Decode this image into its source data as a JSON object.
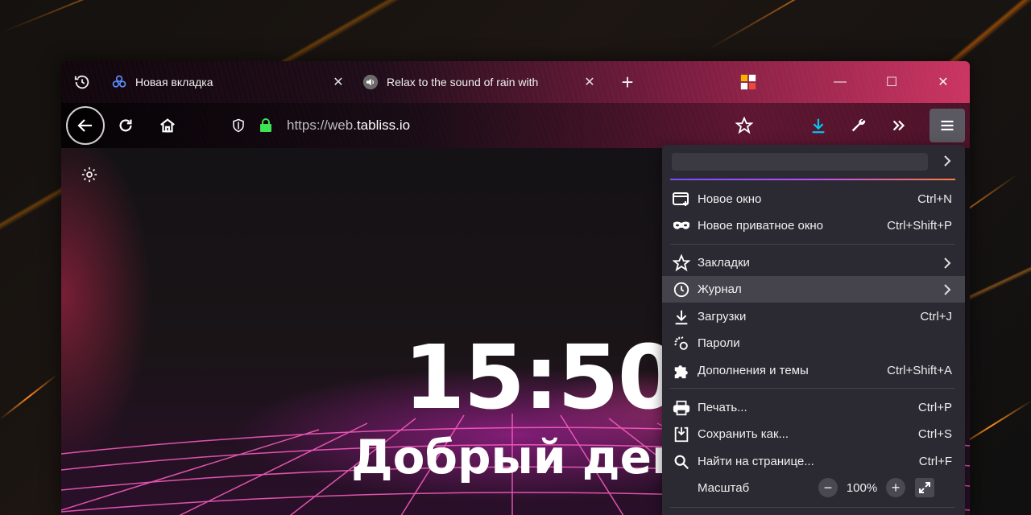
{
  "tabs": [
    {
      "label": "Новая вкладка",
      "close": "✕",
      "active": true
    },
    {
      "label": "Relax to the sound of rain with",
      "close": "✕",
      "active": false
    }
  ],
  "new_tab": "+",
  "url": {
    "prefix": "https://web.",
    "domain": "tabliss.io"
  },
  "window_controls": {
    "minimize": "—",
    "maximize": "☐",
    "close": "✕"
  },
  "page": {
    "time": "15:50",
    "greeting": "Добрый день"
  },
  "menu": {
    "items": [
      {
        "label": "Новое окно",
        "shortcut": "Ctrl+N",
        "icon": "new-window-icon"
      },
      {
        "label": "Новое приватное окно",
        "shortcut": "Ctrl+Shift+P",
        "icon": "private-mask-icon"
      },
      {
        "label": "Закладки",
        "shortcut": "",
        "icon": "star-icon",
        "submenu": true
      },
      {
        "label": "Журнал",
        "shortcut": "",
        "icon": "clock-icon",
        "submenu": true,
        "highlighted": true
      },
      {
        "label": "Загрузки",
        "shortcut": "Ctrl+J",
        "icon": "download-icon"
      },
      {
        "label": "Пароли",
        "shortcut": "",
        "icon": "key-icon"
      },
      {
        "label": "Дополнения и темы",
        "shortcut": "Ctrl+Shift+A",
        "icon": "puzzle-icon"
      },
      {
        "label": "Печать...",
        "shortcut": "Ctrl+P",
        "icon": "printer-icon"
      },
      {
        "label": "Сохранить как...",
        "shortcut": "Ctrl+S",
        "icon": "save-icon"
      },
      {
        "label": "Найти на странице...",
        "shortcut": "Ctrl+F",
        "icon": "search-icon"
      }
    ],
    "zoom": {
      "label": "Масштаб",
      "minus": "−",
      "value": "100%",
      "plus": "+"
    }
  },
  "colors": {
    "accent_download": "#00c8f0",
    "lock_green": "#3fe155",
    "menu_bg": "#2b2a33"
  }
}
